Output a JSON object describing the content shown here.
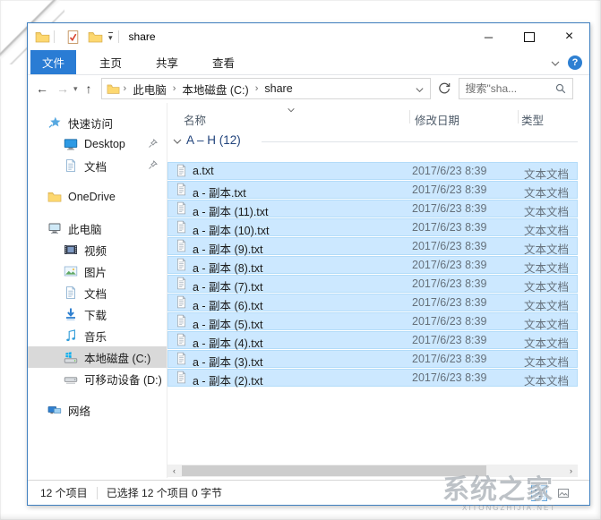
{
  "titlebar": {
    "title": "share"
  },
  "ribbon": {
    "tabs": [
      {
        "label": "文件",
        "selected": true
      },
      {
        "label": "主页",
        "selected": false
      },
      {
        "label": "共享",
        "selected": false
      },
      {
        "label": "查看",
        "selected": false
      }
    ],
    "help_label": "?"
  },
  "nav": {
    "breadcrumb": {
      "items": [
        "此电脑",
        "本地磁盘 (C:)",
        "share"
      ]
    },
    "search": {
      "placeholder_text": "搜索\"sha..."
    }
  },
  "sidebar": {
    "items": [
      {
        "label": "快速访问",
        "icon": "star",
        "indent": 0,
        "pinned": false,
        "selected": false,
        "gap": false
      },
      {
        "label": "Desktop",
        "icon": "monitor",
        "indent": 1,
        "pinned": true,
        "selected": false,
        "gap": false
      },
      {
        "label": "文档",
        "icon": "document",
        "indent": 1,
        "pinned": true,
        "selected": false,
        "gap": false
      },
      {
        "label": "OneDrive",
        "icon": "folder",
        "indent": 0,
        "pinned": false,
        "selected": false,
        "gap": true
      },
      {
        "label": "此电脑",
        "icon": "computer",
        "indent": 0,
        "pinned": false,
        "selected": false,
        "gap": true
      },
      {
        "label": "视频",
        "icon": "film",
        "indent": 1,
        "pinned": false,
        "selected": false,
        "gap": false
      },
      {
        "label": "图片",
        "icon": "picture",
        "indent": 1,
        "pinned": false,
        "selected": false,
        "gap": false
      },
      {
        "label": "文档",
        "icon": "document",
        "indent": 1,
        "pinned": false,
        "selected": false,
        "gap": false
      },
      {
        "label": "下载",
        "icon": "download",
        "indent": 1,
        "pinned": false,
        "selected": false,
        "gap": false
      },
      {
        "label": "音乐",
        "icon": "music",
        "indent": 1,
        "pinned": false,
        "selected": false,
        "gap": false
      },
      {
        "label": "本地磁盘 (C:)",
        "icon": "disk-os",
        "indent": 1,
        "pinned": false,
        "selected": true,
        "gap": false
      },
      {
        "label": "可移动设备 (D:)",
        "icon": "disk",
        "indent": 1,
        "pinned": false,
        "selected": false,
        "gap": false
      },
      {
        "label": "网络",
        "icon": "network",
        "indent": 0,
        "pinned": false,
        "selected": false,
        "gap": true
      }
    ]
  },
  "files": {
    "columns": [
      {
        "label": "名称"
      },
      {
        "label": "修改日期"
      },
      {
        "label": "类型"
      }
    ],
    "group_label": "A – H (12)",
    "rows": [
      {
        "name": "a.txt",
        "date": "2017/6/23 8:39",
        "type": "文本文档"
      },
      {
        "name": "a - 副本.txt",
        "date": "2017/6/23 8:39",
        "type": "文本文档"
      },
      {
        "name": "a - 副本 (11).txt",
        "date": "2017/6/23 8:39",
        "type": "文本文档"
      },
      {
        "name": "a - 副本 (10).txt",
        "date": "2017/6/23 8:39",
        "type": "文本文档"
      },
      {
        "name": "a - 副本 (9).txt",
        "date": "2017/6/23 8:39",
        "type": "文本文档"
      },
      {
        "name": "a - 副本 (8).txt",
        "date": "2017/6/23 8:39",
        "type": "文本文档"
      },
      {
        "name": "a - 副本 (7).txt",
        "date": "2017/6/23 8:39",
        "type": "文本文档"
      },
      {
        "name": "a - 副本 (6).txt",
        "date": "2017/6/23 8:39",
        "type": "文本文档"
      },
      {
        "name": "a - 副本 (5).txt",
        "date": "2017/6/23 8:39",
        "type": "文本文档"
      },
      {
        "name": "a - 副本 (4).txt",
        "date": "2017/6/23 8:39",
        "type": "文本文档"
      },
      {
        "name": "a - 副本 (3).txt",
        "date": "2017/6/23 8:39",
        "type": "文本文档"
      },
      {
        "name": "a - 副本 (2).txt",
        "date": "2017/6/23 8:39",
        "type": "文本文档"
      }
    ]
  },
  "status": {
    "count_text": "12 个项目",
    "selection_text": "已选择 12 个项目  0 字节"
  },
  "watermark": {
    "title": "系统之家",
    "subtitle": "XITONGZHIJIA.NET"
  },
  "icons": {
    "explorer": "folder",
    "qat_button_1": "check-doc",
    "qat_button_2": "folder",
    "back": "←",
    "forward": "→",
    "up": "↑",
    "refresh": "clockwise-arrow",
    "search": "magnifier",
    "sort_indicator": "chevron-down",
    "group_expander": "chevron-down",
    "pin": "pushpin",
    "minimize": "─",
    "maximize": "□",
    "close": "×"
  },
  "colors": {
    "accent_blue": "#2a7cd4",
    "selection_blue": "#cce8ff",
    "selection_border": "#b3dcf9",
    "window_border": "#3f7fbf",
    "sidebar_selected": "#d9d9d9",
    "group_text": "#22447c",
    "header_text": "#4e5b69",
    "muted_text": "#65707b"
  }
}
